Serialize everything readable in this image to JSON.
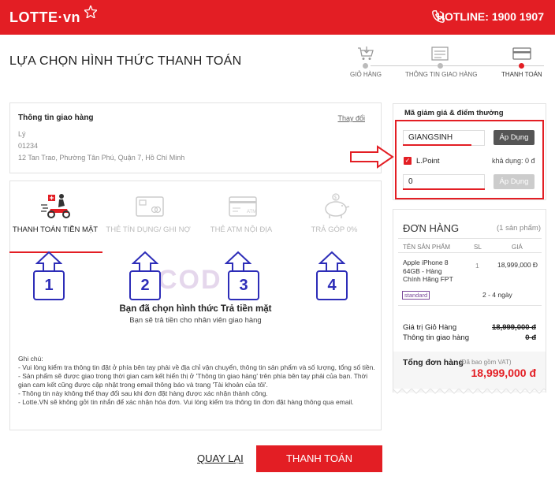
{
  "header": {
    "logo_text": "LOTTE·vn",
    "hotline": "HOTLINE: 1900 1907",
    "brand_color": "#e31e24"
  },
  "page_title": "LỰA CHỌN HÌNH THỨC THANH TOÁN",
  "steps": [
    {
      "label": "GIỎ HÀNG",
      "icon": "cart-icon",
      "active": false
    },
    {
      "label": "THÔNG TIN GIAO HÀNG",
      "icon": "form-icon",
      "active": false
    },
    {
      "label": "THANH TOÁN",
      "icon": "credit-card-icon",
      "active": true
    }
  ],
  "shipping": {
    "title": "Thông tin giao hàng",
    "change_label": "Thay đổi",
    "name": "Lý",
    "phone": "01234",
    "address": "12 Tan Trao, Phường Tân Phú, Quận 7, Hồ Chí Minh"
  },
  "payment_tabs": [
    {
      "label": "THANH TOÁN TIỀN MẶT",
      "icon": "delivery-scooter-icon",
      "active": true
    },
    {
      "label": "THẺ TÍN DỤNG/ GHI NỢ",
      "icon": "credit-card-icon",
      "active": false
    },
    {
      "label": "THẺ ATM NỘI ĐỊA",
      "icon": "atm-card-icon",
      "active": false
    },
    {
      "label": "TRẢ GÓP 0%",
      "icon": "piggy-bank-icon",
      "active": false
    }
  ],
  "annotations": [
    "1",
    "2",
    "3",
    "4"
  ],
  "watermark": "COD",
  "chosen": {
    "title": "Bạn đã chọn hình thức Trả tiền mặt",
    "subtitle": "Bạn sẽ trả tiền cho nhân viên giao hàng"
  },
  "notes": {
    "heading": "Ghi chú:",
    "lines": [
      "- Vui lòng kiểm tra thông tin đặt ở phía bên tay phải về địa chỉ vận chuyển, thông tin sản phẩm và số lượng, tổng số tiền.",
      "- Sản phẩm sẽ được giao trong thời gian cam kết hiển thị ở 'Thông tin giao hàng' trên phía bên tay phải của bạn. Thời gian cam kết cũng được cập nhật trong email thông báo và trang 'Tài khoản của tôi'.",
      "- Thông tin này không thể thay đổi sau khi đơn đặt hàng được xác nhận thành công.",
      "- Lotte.VN sẽ không gởi tin nhắn để xác nhận hóa đơn. Vui lòng kiểm tra thông tin đơn đặt hàng thông qua email."
    ]
  },
  "actions": {
    "back_label": "QUAY LẠI",
    "pay_label": "THANH TOÁN"
  },
  "promo": {
    "title": "Mã giảm giá & điểm thưởng",
    "code_value": "GIANGSINH",
    "apply_label": "Áp Dụng",
    "lpoint_label": "L.Point",
    "available_label": "khả dụng: 0 đ",
    "points_value": "0",
    "apply2_label": "Áp Dụng"
  },
  "order": {
    "title": "ĐƠN HÀNG",
    "count": "(1 sản phẩm)",
    "columns": [
      "TÊN SẢN PHẨM",
      "SL",
      "GIÁ"
    ],
    "product": {
      "name": "Apple iPhone 8 64GB - Hàng Chính Hãng FPT",
      "qty": "1",
      "price": "18,999,000 Đ",
      "shipping_tag": "standard",
      "delivery": "2 - 4 ngày"
    },
    "cart_value_label": "Giá trị Giỏ Hàng",
    "cart_value": "18,999,000 đ",
    "shipping_label": "Thông tin giao hàng",
    "shipping_value": "0 đ",
    "total_label": "Tổng đơn hàng",
    "total_note": "(Đã bao gồm VAT)",
    "total_value": "18,999,000 đ"
  }
}
